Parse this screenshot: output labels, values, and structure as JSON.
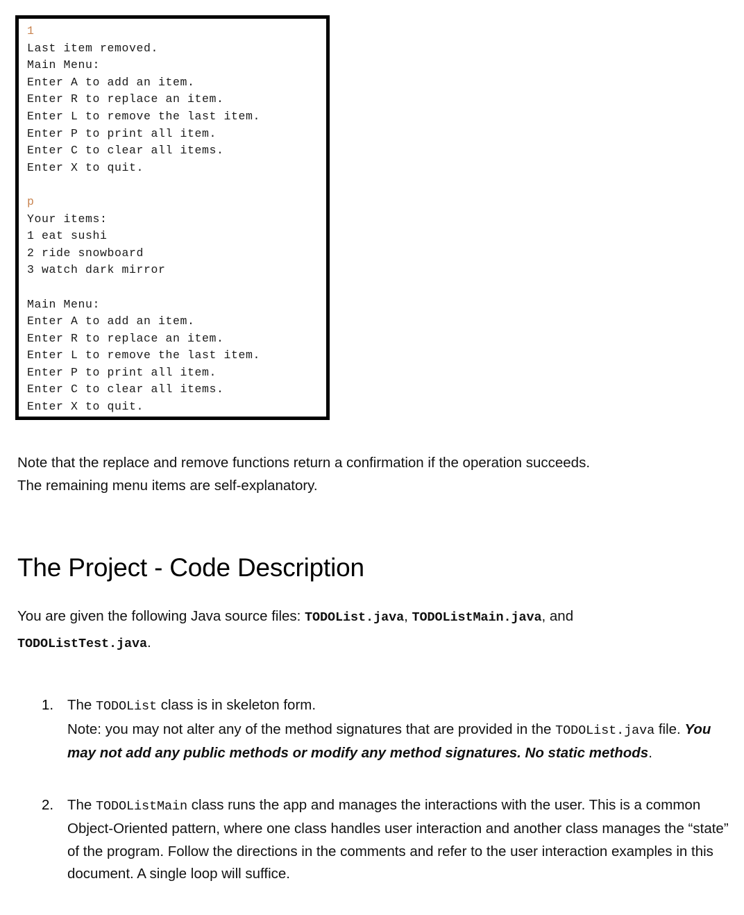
{
  "terminal": {
    "lines": [
      {
        "text": "1",
        "kind": "input"
      },
      {
        "text": "Last item removed.",
        "kind": "output"
      },
      {
        "text": "Main Menu:",
        "kind": "output"
      },
      {
        "text": "Enter A to add an item.",
        "kind": "output"
      },
      {
        "text": "Enter R to replace an item.",
        "kind": "output"
      },
      {
        "text": "Enter L to remove the last item.",
        "kind": "output"
      },
      {
        "text": "Enter P to print all item.",
        "kind": "output"
      },
      {
        "text": "Enter C to clear all items.",
        "kind": "output"
      },
      {
        "text": "Enter X to quit.",
        "kind": "output"
      },
      {
        "text": " ",
        "kind": "blank"
      },
      {
        "text": "p",
        "kind": "input"
      },
      {
        "text": "Your items:",
        "kind": "output"
      },
      {
        "text": "1 eat sushi",
        "kind": "output"
      },
      {
        "text": "2 ride snowboard",
        "kind": "output"
      },
      {
        "text": "3 watch dark mirror",
        "kind": "output"
      },
      {
        "text": " ",
        "kind": "blank"
      },
      {
        "text": "Main Menu:",
        "kind": "output"
      },
      {
        "text": "Enter A to add an item.",
        "kind": "output"
      },
      {
        "text": "Enter R to replace an item.",
        "kind": "output"
      },
      {
        "text": "Enter L to remove the last item.",
        "kind": "output"
      },
      {
        "text": "Enter P to print all item.",
        "kind": "output"
      },
      {
        "text": "Enter C to clear all items.",
        "kind": "output"
      },
      {
        "text": "Enter X to quit.",
        "kind": "output"
      }
    ],
    "input_color": "#c8834f",
    "output_color": "#1a1a1a",
    "border_color": "#000000",
    "background_color": "#ffffff"
  },
  "note": {
    "line1": "Note that the replace and remove functions return a confirmation if the operation succeeds.",
    "line2": "The remaining menu items are self-explanatory."
  },
  "heading": {
    "title": "The Project - Code Description"
  },
  "files_paragraph": {
    "lead": "You are given the following Java source files: ",
    "file1": "TODOList.java",
    "sep1": ", ",
    "file2": "TODOListMain.java",
    "sep2": ", and",
    "file3": "TODOListTest.java",
    "trailing": "."
  },
  "list": {
    "items": [
      {
        "marker": "1.",
        "seg1": "The ",
        "code1": "TODOList",
        "seg2": " class is in skeleton form.",
        "seg3": "Note: you may not alter any of the method signatures that are provided in the ",
        "code2": "TODOList.java",
        "seg4": " file. ",
        "emphasis": "You may not add any public methods or modify any method signatures. No static methods",
        "seg5": "."
      },
      {
        "marker": "2.",
        "seg1": "The ",
        "code1": "TODOListMain",
        "seg2": " class runs the app and manages the interactions with the user. This is a common Object-Oriented pattern, where one class handles user interaction and another class manages the “state” of the program. Follow the directions in the comments and refer to the user interaction examples in this document. A single loop will suffice."
      }
    ]
  }
}
